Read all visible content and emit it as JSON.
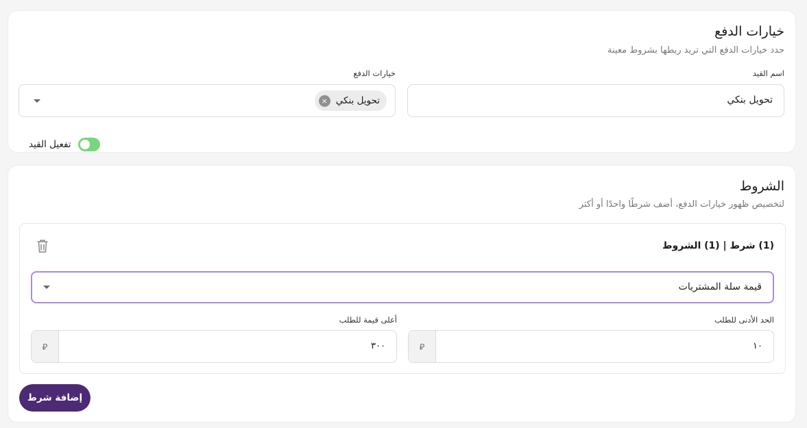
{
  "payment_options": {
    "title": "خيارات الدفع",
    "subtitle": "حدد خيارات الدفع التي تريد ربطها بشروط معينة",
    "rule_name_label": "اسم القيد",
    "rule_name_value": "تحويل بنكي",
    "payment_options_label": "خيارات الدفع",
    "selected_option_chip": "تحويل بنكي",
    "chip_remove_icon": "×",
    "toggle_label": "تفعيل القيد",
    "toggle_on": true,
    "toggle_color": "#7ad67d"
  },
  "conditions": {
    "title": "الشروط",
    "subtitle": "لتخصيص ظهور خيارات الدفع، أضف شرطًا واحدًا أو أكثر",
    "condition_header": "(1) شرط | (1) الشروط",
    "delete_icon": "trash-icon",
    "condition_type_value": "قيمة سلة المشتريات",
    "min_label": "الحد الأدنى للطلب",
    "min_value": "١٠",
    "max_label": "أعلى قيمة للطلب",
    "max_value": "٣٠٠",
    "currency_symbol": "⃁",
    "add_condition_button": "إضافة شرط",
    "accent_color": "#4c2a74",
    "focus_border_color": "#a98bdf"
  }
}
